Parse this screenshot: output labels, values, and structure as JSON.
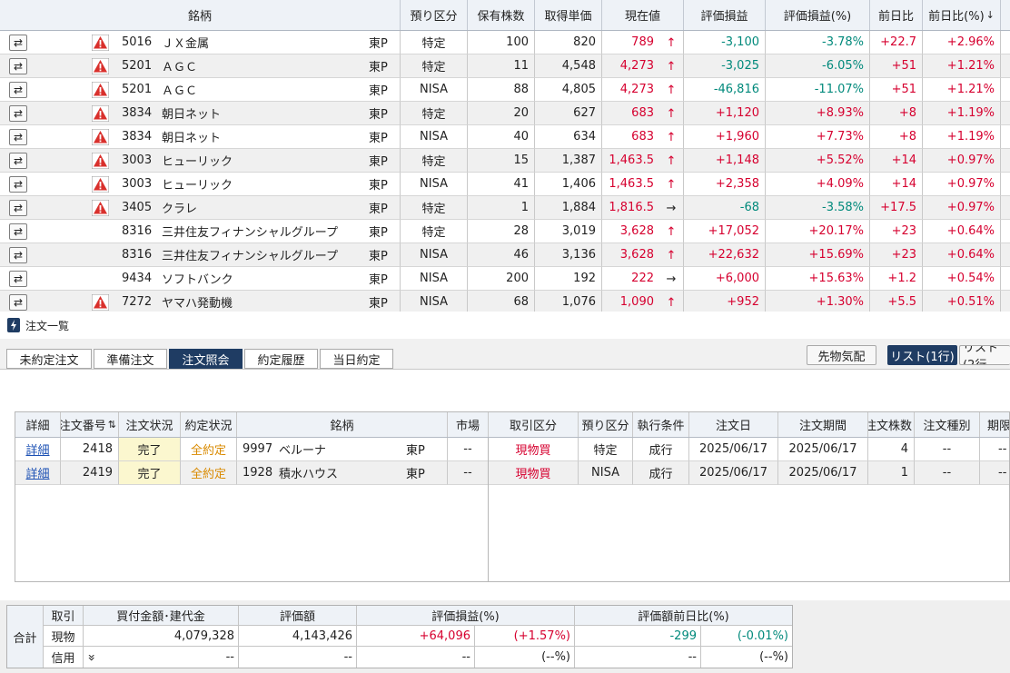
{
  "holdings": {
    "headers": [
      "銘柄",
      "預り区分",
      "保有株数",
      "取得単価",
      "現在値",
      "評価損益",
      "評価損益(%)",
      "前日比",
      "前日比(%)"
    ],
    "sort_indicator": "↓",
    "swap_icon": "⇄",
    "rows": [
      {
        "code": "5016",
        "name": "ＪＸ金属",
        "market": "東P",
        "account": "特定",
        "qty": "100",
        "cost": "820",
        "price": "789",
        "arrow": "↑",
        "pl": "-3,100",
        "pl_pct": "-3.78%",
        "chg": "+22.7",
        "chg_pct": "+2.96%",
        "warn": true,
        "price_color": "red",
        "pl_color": "green"
      },
      {
        "code": "5201",
        "name": "ＡＧＣ",
        "market": "東P",
        "account": "特定",
        "qty": "11",
        "cost": "4,548",
        "price": "4,273",
        "arrow": "↑",
        "pl": "-3,025",
        "pl_pct": "-6.05%",
        "chg": "+51",
        "chg_pct": "+1.21%",
        "warn": true,
        "price_color": "red",
        "pl_color": "green"
      },
      {
        "code": "5201",
        "name": "ＡＧＣ",
        "market": "東P",
        "account": "NISA",
        "qty": "88",
        "cost": "4,805",
        "price": "4,273",
        "arrow": "↑",
        "pl": "-46,816",
        "pl_pct": "-11.07%",
        "chg": "+51",
        "chg_pct": "+1.21%",
        "warn": true,
        "price_color": "red",
        "pl_color": "green"
      },
      {
        "code": "3834",
        "name": "朝日ネット",
        "market": "東P",
        "account": "特定",
        "qty": "20",
        "cost": "627",
        "price": "683",
        "arrow": "↑",
        "pl": "+1,120",
        "pl_pct": "+8.93%",
        "chg": "+8",
        "chg_pct": "+1.19%",
        "warn": true,
        "price_color": "red",
        "pl_color": "red"
      },
      {
        "code": "3834",
        "name": "朝日ネット",
        "market": "東P",
        "account": "NISA",
        "qty": "40",
        "cost": "634",
        "price": "683",
        "arrow": "↑",
        "pl": "+1,960",
        "pl_pct": "+7.73%",
        "chg": "+8",
        "chg_pct": "+1.19%",
        "warn": true,
        "price_color": "red",
        "pl_color": "red"
      },
      {
        "code": "3003",
        "name": "ヒューリック",
        "market": "東P",
        "account": "特定",
        "qty": "15",
        "cost": "1,387",
        "price": "1,463.5",
        "arrow": "↑",
        "pl": "+1,148",
        "pl_pct": "+5.52%",
        "chg": "+14",
        "chg_pct": "+0.97%",
        "warn": true,
        "price_color": "red",
        "pl_color": "red"
      },
      {
        "code": "3003",
        "name": "ヒューリック",
        "market": "東P",
        "account": "NISA",
        "qty": "41",
        "cost": "1,406",
        "price": "1,463.5",
        "arrow": "↑",
        "pl": "+2,358",
        "pl_pct": "+4.09%",
        "chg": "+14",
        "chg_pct": "+0.97%",
        "warn": true,
        "price_color": "red",
        "pl_color": "red"
      },
      {
        "code": "3405",
        "name": "クラレ",
        "market": "東P",
        "account": "特定",
        "qty": "1",
        "cost": "1,884",
        "price": "1,816.5",
        "arrow": "→",
        "pl": "-68",
        "pl_pct": "-3.58%",
        "chg": "+17.5",
        "chg_pct": "+0.97%",
        "warn": true,
        "price_color": "red",
        "pl_color": "green"
      },
      {
        "code": "8316",
        "name": "三井住友フィナンシャルグループ",
        "market": "東P",
        "account": "特定",
        "qty": "28",
        "cost": "3,019",
        "price": "3,628",
        "arrow": "↑",
        "pl": "+17,052",
        "pl_pct": "+20.17%",
        "chg": "+23",
        "chg_pct": "+0.64%",
        "warn": false,
        "price_color": "red",
        "pl_color": "red"
      },
      {
        "code": "8316",
        "name": "三井住友フィナンシャルグループ",
        "market": "東P",
        "account": "NISA",
        "qty": "46",
        "cost": "3,136",
        "price": "3,628",
        "arrow": "↑",
        "pl": "+22,632",
        "pl_pct": "+15.69%",
        "chg": "+23",
        "chg_pct": "+0.64%",
        "warn": false,
        "price_color": "red",
        "pl_color": "red"
      },
      {
        "code": "9434",
        "name": "ソフトバンク",
        "market": "東P",
        "account": "NISA",
        "qty": "200",
        "cost": "192",
        "price": "222",
        "arrow": "→",
        "pl": "+6,000",
        "pl_pct": "+15.63%",
        "chg": "+1.2",
        "chg_pct": "+0.54%",
        "warn": false,
        "price_color": "red",
        "pl_color": "red"
      },
      {
        "code": "7272",
        "name": "ヤマハ発動機",
        "market": "東P",
        "account": "NISA",
        "qty": "68",
        "cost": "1,076",
        "price": "1,090",
        "arrow": "↑",
        "pl": "+952",
        "pl_pct": "+1.30%",
        "chg": "+5.5",
        "chg_pct": "+0.51%",
        "warn": true,
        "price_color": "red",
        "pl_color": "red"
      }
    ]
  },
  "orders": {
    "panel_title": "注文一覧",
    "tabs": [
      "未約定注文",
      "準備注文",
      "注文照会",
      "約定履歴",
      "当日約定"
    ],
    "active_tab": 2,
    "tool_buttons": [
      "先物気配",
      "リスト(1行)",
      "リスト(2行"
    ],
    "headers": [
      "詳細",
      "注文番号",
      "注文状況",
      "約定状況",
      "銘柄",
      "市場",
      "取引区分",
      "預り区分",
      "執行条件",
      "注文日",
      "注文期間",
      "注文株数",
      "注文種別",
      "期限"
    ],
    "sort_indicator": "⇅",
    "rows": [
      {
        "detail": "詳細",
        "order_no": "2418",
        "status": "完了",
        "exec_status": "全約定",
        "code": "9997",
        "name": "ベルーナ",
        "market": "東P",
        "exchange": "--",
        "trade_type": "現物買",
        "account": "特定",
        "exec_cond": "成行",
        "order_date": "2025/06/17",
        "period": "2025/06/17",
        "qty": "4",
        "order_kind": "--",
        "expiry": "--"
      },
      {
        "detail": "詳細",
        "order_no": "2419",
        "status": "完了",
        "exec_status": "全約定",
        "code": "1928",
        "name": "積水ハウス",
        "market": "東P",
        "exchange": "--",
        "trade_type": "現物買",
        "account": "NISA",
        "exec_cond": "成行",
        "order_date": "2025/06/17",
        "period": "2025/06/17",
        "qty": "1",
        "order_kind": "--",
        "expiry": "--"
      }
    ]
  },
  "summary": {
    "total_label": "合計",
    "headers": [
      "取引",
      "買付金額･建代金",
      "評価額",
      "評価損益(%)",
      "評価額前日比(%)"
    ],
    "rows": [
      {
        "label": "現物",
        "buy": "4,079,328",
        "value": "4,143,426",
        "pl": "+64,096",
        "pl_pct": "(+1.57%)",
        "chg": "-299",
        "chg_pct": "(-0.01%)"
      },
      {
        "label": "信用",
        "buy": "--",
        "value": "--",
        "pl": "--",
        "pl_pct": "(--%)",
        "chg": "--",
        "chg_pct": "(--%)"
      }
    ],
    "expand_icon": "»"
  },
  "colors": {
    "accent": "#1f3c63",
    "up": "#d6002f",
    "down": "#00897b",
    "warn": "#d9302c",
    "link": "#1a4fb3",
    "filled": "#d98a00"
  }
}
